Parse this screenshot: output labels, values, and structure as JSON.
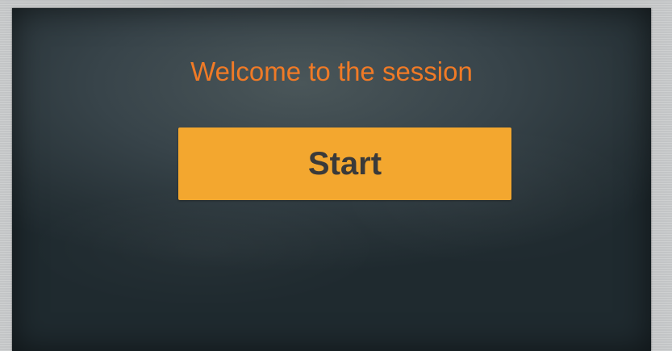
{
  "welcome": {
    "message": "Welcome to the session"
  },
  "actions": {
    "start_label": "Start"
  },
  "colors": {
    "accent": "#f3a72f",
    "welcome_text": "#f07a26",
    "board": "#2f3b40",
    "button_text": "#3a3a3a"
  }
}
